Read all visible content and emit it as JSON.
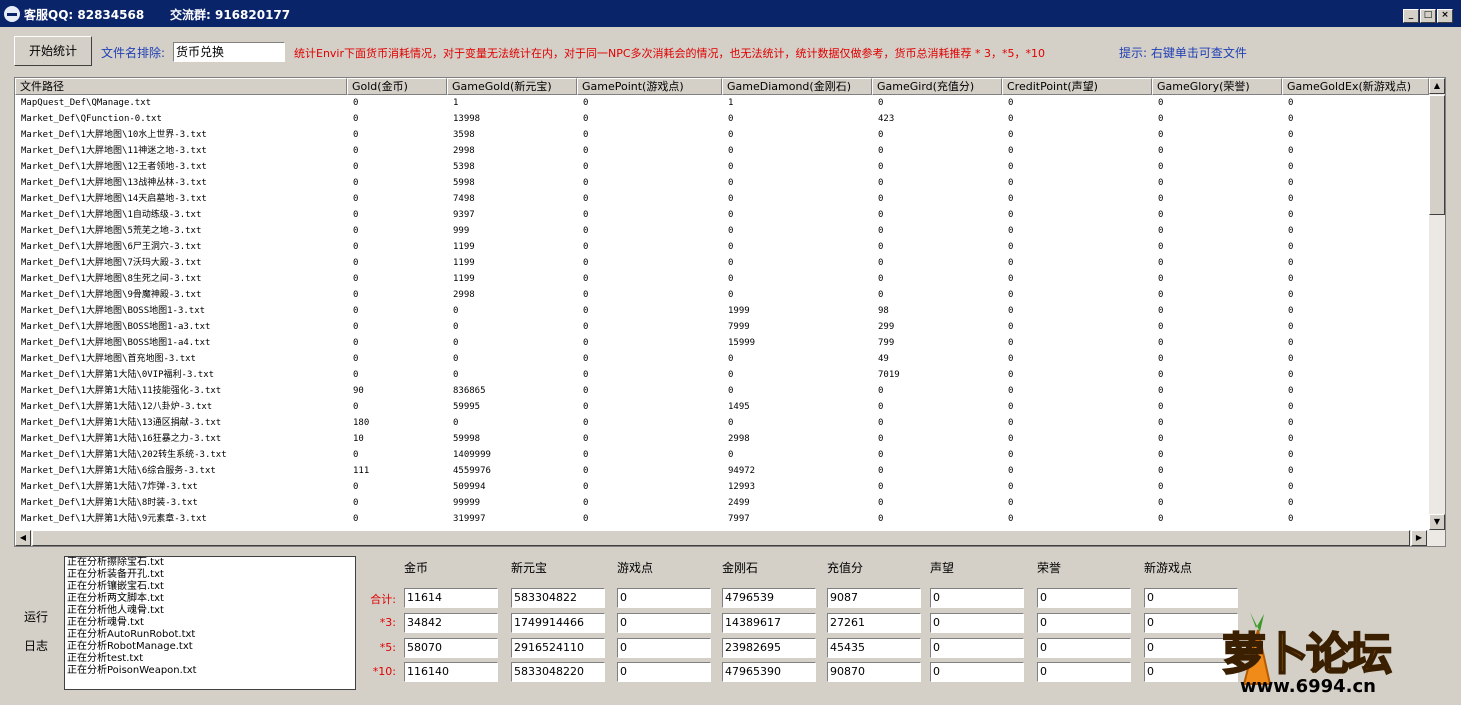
{
  "titlebar": {
    "contact_label": "客服QQ: 82834568",
    "group_label": "交流群: 916820177"
  },
  "toolbar": {
    "start_button": "开始统计",
    "exclude_label": "文件名排除:",
    "exclude_value": "货币兑换",
    "info": "统计Envir下面货币消耗情况，对于变量无法统计在内，对于同一NPC多次消耗会的情况，也无法统计，统计数据仅做参考，货币总消耗推荐 * 3，*5，*10",
    "hint": "提示: 右键单击可查文件"
  },
  "grid": {
    "columns": [
      "文件路径",
      "Gold(金币)",
      "GameGold(新元宝)",
      "GamePoint(游戏点)",
      "GameDiamond(金刚石)",
      "GameGird(充值分)",
      "CreditPoint(声望)",
      "GameGlory(荣誉)",
      "GameGoldEx(新游戏点)"
    ],
    "rows": [
      [
        "MapQuest_Def\\QManage.txt",
        "0",
        "1",
        "0",
        "1",
        "0",
        "0",
        "0",
        "0"
      ],
      [
        "Market_Def\\QFunction-0.txt",
        "0",
        "13998",
        "0",
        "0",
        "423",
        "0",
        "0",
        "0"
      ],
      [
        "Market_Def\\1大胖地图\\10水上世界-3.txt",
        "0",
        "3598",
        "0",
        "0",
        "0",
        "0",
        "0",
        "0"
      ],
      [
        "Market_Def\\1大胖地图\\11神迷之地-3.txt",
        "0",
        "2998",
        "0",
        "0",
        "0",
        "0",
        "0",
        "0"
      ],
      [
        "Market_Def\\1大胖地图\\12王者领地-3.txt",
        "0",
        "5398",
        "0",
        "0",
        "0",
        "0",
        "0",
        "0"
      ],
      [
        "Market_Def\\1大胖地图\\13战神丛林-3.txt",
        "0",
        "5998",
        "0",
        "0",
        "0",
        "0",
        "0",
        "0"
      ],
      [
        "Market_Def\\1大胖地图\\14天启墓地-3.txt",
        "0",
        "7498",
        "0",
        "0",
        "0",
        "0",
        "0",
        "0"
      ],
      [
        "Market_Def\\1大胖地图\\1自动练级-3.txt",
        "0",
        "9397",
        "0",
        "0",
        "0",
        "0",
        "0",
        "0"
      ],
      [
        "Market_Def\\1大胖地图\\5荒芜之地-3.txt",
        "0",
        "999",
        "0",
        "0",
        "0",
        "0",
        "0",
        "0"
      ],
      [
        "Market_Def\\1大胖地图\\6尸王洞穴-3.txt",
        "0",
        "1199",
        "0",
        "0",
        "0",
        "0",
        "0",
        "0"
      ],
      [
        "Market_Def\\1大胖地图\\7沃玛大殿-3.txt",
        "0",
        "1199",
        "0",
        "0",
        "0",
        "0",
        "0",
        "0"
      ],
      [
        "Market_Def\\1大胖地图\\8生死之间-3.txt",
        "0",
        "1199",
        "0",
        "0",
        "0",
        "0",
        "0",
        "0"
      ],
      [
        "Market_Def\\1大胖地图\\9骨魔神殿-3.txt",
        "0",
        "2998",
        "0",
        "0",
        "0",
        "0",
        "0",
        "0"
      ],
      [
        "Market_Def\\1大胖地图\\BOSS地图1-3.txt",
        "0",
        "0",
        "0",
        "1999",
        "98",
        "0",
        "0",
        "0"
      ],
      [
        "Market_Def\\1大胖地图\\BOSS地图1-a3.txt",
        "0",
        "0",
        "0",
        "7999",
        "299",
        "0",
        "0",
        "0"
      ],
      [
        "Market_Def\\1大胖地图\\BOSS地图1-a4.txt",
        "0",
        "0",
        "0",
        "15999",
        "799",
        "0",
        "0",
        "0"
      ],
      [
        "Market_Def\\1大胖地图\\首充地图-3.txt",
        "0",
        "0",
        "0",
        "0",
        "49",
        "0",
        "0",
        "0"
      ],
      [
        "Market_Def\\1大胖第1大陆\\0VIP福利-3.txt",
        "0",
        "0",
        "0",
        "0",
        "7019",
        "0",
        "0",
        "0"
      ],
      [
        "Market_Def\\1大胖第1大陆\\11技能强化-3.txt",
        "90",
        "836865",
        "0",
        "0",
        "0",
        "0",
        "0",
        "0"
      ],
      [
        "Market_Def\\1大胖第1大陆\\12八卦炉-3.txt",
        "0",
        "59995",
        "0",
        "1495",
        "0",
        "0",
        "0",
        "0"
      ],
      [
        "Market_Def\\1大胖第1大陆\\13通区捐献-3.txt",
        "180",
        "0",
        "0",
        "0",
        "0",
        "0",
        "0",
        "0"
      ],
      [
        "Market_Def\\1大胖第1大陆\\16狂暴之力-3.txt",
        "10",
        "59998",
        "0",
        "2998",
        "0",
        "0",
        "0",
        "0"
      ],
      [
        "Market_Def\\1大胖第1大陆\\202转生系统-3.txt",
        "0",
        "1409999",
        "0",
        "0",
        "0",
        "0",
        "0",
        "0"
      ],
      [
        "Market_Def\\1大胖第1大陆\\6综合服务-3.txt",
        "111",
        "4559976",
        "0",
        "94972",
        "0",
        "0",
        "0",
        "0"
      ],
      [
        "Market_Def\\1大胖第1大陆\\7炸弹-3.txt",
        "0",
        "509994",
        "0",
        "12993",
        "0",
        "0",
        "0",
        "0"
      ],
      [
        "Market_Def\\1大胖第1大陆\\8时装-3.txt",
        "0",
        "99999",
        "0",
        "2499",
        "0",
        "0",
        "0",
        "0"
      ],
      [
        "Market_Def\\1大胖第1大陆\\9元素章-3.txt",
        "0",
        "319997",
        "0",
        "7997",
        "0",
        "0",
        "0",
        "0"
      ]
    ]
  },
  "log": {
    "label_top": "运行",
    "label_bottom": "日志",
    "lines": [
      "正在分析擦除宝石.txt",
      "正在分析装备开孔.txt",
      "正在分析镶嵌宝石.txt",
      "正在分析两文脚本.txt",
      "正在分析他人魂骨.txt",
      "正在分析魂骨.txt",
      "正在分析AutoRunRobot.txt",
      "正在分析RobotManage.txt",
      "正在分析test.txt",
      "正在分析PoisonWeapon.txt"
    ]
  },
  "summary": {
    "headers": [
      "金币",
      "新元宝",
      "游戏点",
      "金刚石",
      "充值分",
      "声望",
      "荣誉",
      "新游戏点"
    ],
    "rows": [
      {
        "label": "合计:",
        "values": [
          "11614",
          "583304822",
          "0",
          "4796539",
          "9087",
          "0",
          "0",
          "0"
        ]
      },
      {
        "label": "*3:",
        "values": [
          "34842",
          "1749914466",
          "0",
          "14389617",
          "27261",
          "0",
          "0",
          "0"
        ]
      },
      {
        "label": "*5:",
        "values": [
          "58070",
          "2916524110",
          "0",
          "23982695",
          "45435",
          "0",
          "0",
          "0"
        ]
      },
      {
        "label": "*10:",
        "values": [
          "116140",
          "5833048220",
          "0",
          "47965390",
          "90870",
          "0",
          "0",
          "0"
        ]
      }
    ]
  },
  "watermark": {
    "text": "萝卜论坛",
    "url": "www.6994.cn"
  }
}
